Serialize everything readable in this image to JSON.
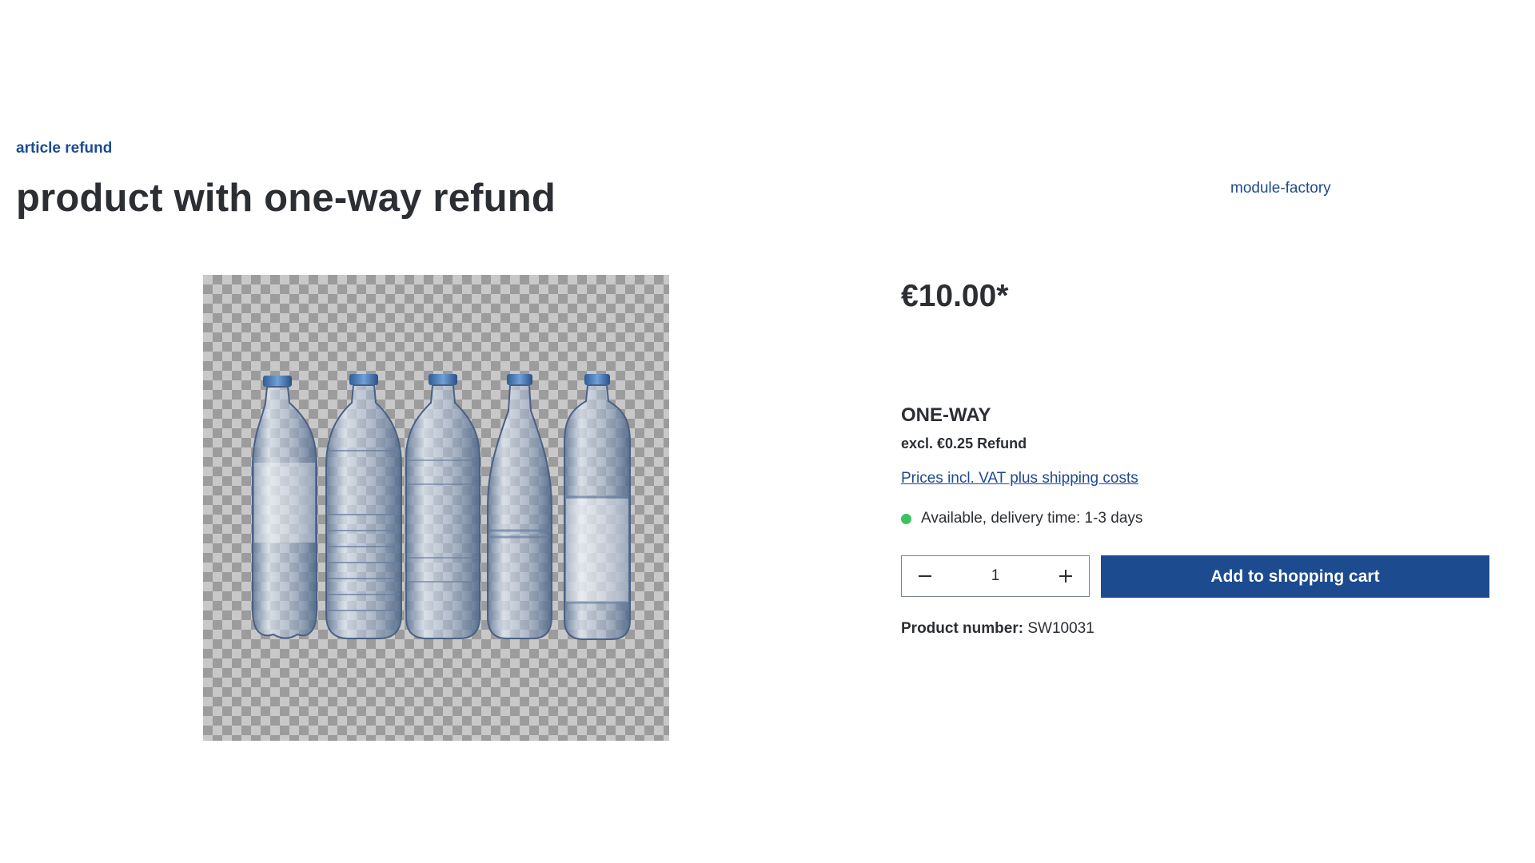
{
  "breadcrumb": {
    "category": "article refund"
  },
  "product": {
    "title": "product with one-way refund",
    "manufacturer": "module-factory",
    "price": "€10.00*",
    "refund_type": "ONE-WAY",
    "refund_note": "excl. €0.25 Refund",
    "tax_link": "Prices incl. VAT plus shipping costs",
    "availability": "Available, delivery time: 1-3 days",
    "availability_color": "#3cc261",
    "quantity": "1",
    "add_to_cart_label": "Add to shopping cart",
    "product_number_label": "Product number:",
    "product_number": "SW10031",
    "image_icon": "water-bottles-image"
  },
  "colors": {
    "accent": "#1d4b8f",
    "text": "#2b2e33"
  }
}
